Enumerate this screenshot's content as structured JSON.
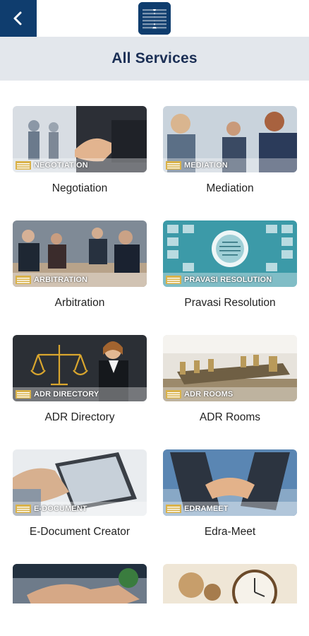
{
  "header": {
    "back_icon": "chevron-left-icon",
    "logo": "edra-logo",
    "title": "All Services"
  },
  "colors": {
    "primary": "#0f3d6e",
    "title_bar": "#e3e7ec",
    "title_text": "#1b2f55"
  },
  "services": [
    {
      "banner": "NEGOTIATION",
      "label": "Negotiation"
    },
    {
      "banner": "MEDIATION",
      "label": "Mediation"
    },
    {
      "banner": "ARBITRATION",
      "label": "Arbitration"
    },
    {
      "banner": "PRAVASI RESOLUTION",
      "label": "Pravasi Resolution"
    },
    {
      "banner": "ADR DIRECTORY",
      "label": "ADR Directory"
    },
    {
      "banner": "ADR ROOMS",
      "label": "ADR Rooms"
    },
    {
      "banner": "E-DOCUMENT",
      "label": "E-Document Creator"
    },
    {
      "banner": "EDRAMEET",
      "label": "Edra-Meet"
    },
    {
      "banner": "",
      "label": ""
    },
    {
      "banner": "",
      "label": ""
    }
  ]
}
